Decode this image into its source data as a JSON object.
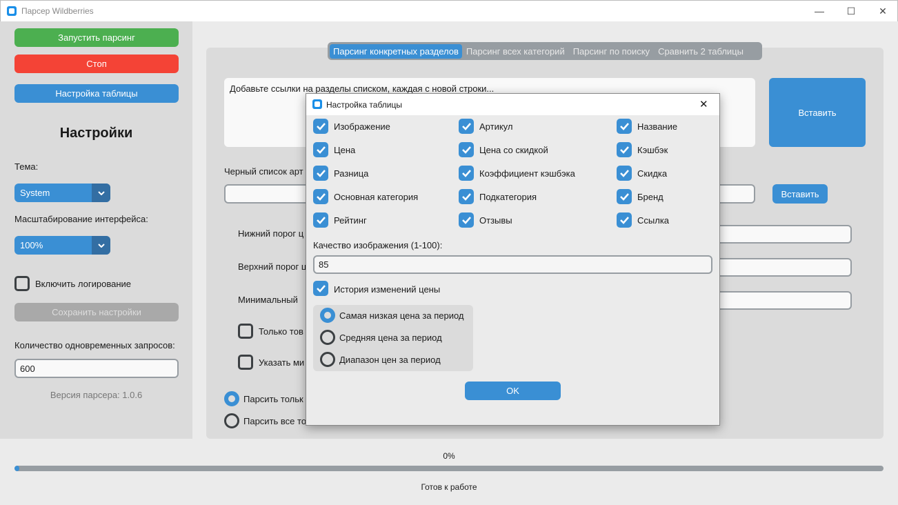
{
  "window": {
    "title": "Парсер Wildberries",
    "minimize": "—",
    "maximize": "☐",
    "close": "✕"
  },
  "sidebar": {
    "start_label": "Запустить парсинг",
    "stop_label": "Стоп",
    "table_settings_label": "Настройка таблицы",
    "heading": "Настройки",
    "theme_label": "Тема:",
    "theme_value": "System",
    "scale_label": "Масштабирование интерфейса:",
    "scale_value": "100%",
    "logging_label": "Включить логирование",
    "save_label": "Сохранить настройки",
    "requests_label": "Количество одновременных запросов:",
    "requests_value": "600",
    "version": "Версия парсера: 1.0.6"
  },
  "tabs": [
    {
      "label": "Парсинг конкретных разделов",
      "active": true
    },
    {
      "label": "Парсинг всех категорий"
    },
    {
      "label": "Парсинг по поиску"
    },
    {
      "label": "Сравнить 2 таблицы"
    }
  ],
  "main": {
    "links_placeholder": "Добавьте ссылки на разделы списком, каждая с новой строки...",
    "insert_label": "Вставить",
    "blacklist_label": "Черный список арт",
    "insert_small_label": "Вставить",
    "min_price_label": "Нижний порог ц",
    "max_price_label": "Верхний порог ц",
    "min_label": "Минимальный",
    "only_check_label": "Только тов",
    "specify_check_label": "Указать ми",
    "radio_only": "Парсить тольк",
    "radio_all": "Парсить все то"
  },
  "footer": {
    "progress_text": "0%",
    "progress": 0.003,
    "status": "Готов к работе"
  },
  "dialog": {
    "title": "Настройка таблицы",
    "close": "✕",
    "columns": [
      {
        "label": "Изображение",
        "checked": true
      },
      {
        "label": "Артикул",
        "checked": true
      },
      {
        "label": "Название",
        "checked": true
      },
      {
        "label": "Цена",
        "checked": true
      },
      {
        "label": "Цена со скидкой",
        "checked": true
      },
      {
        "label": "Кэшбэк",
        "checked": true
      },
      {
        "label": "Разница",
        "checked": true
      },
      {
        "label": "Коэффициент кэшбэка",
        "checked": true
      },
      {
        "label": "Скидка",
        "checked": true
      },
      {
        "label": "Основная категория",
        "checked": true
      },
      {
        "label": "Подкатегория",
        "checked": true
      },
      {
        "label": "Бренд",
        "checked": true
      },
      {
        "label": "Рейтинг",
        "checked": true
      },
      {
        "label": "Отзывы",
        "checked": true
      },
      {
        "label": "Ссылка",
        "checked": true
      }
    ],
    "quality_label": "Качество изображения (1-100):",
    "quality_value": "85",
    "history_label": "История изменений цены",
    "radios": [
      {
        "label": "Самая низкая цена за период",
        "selected": true
      },
      {
        "label": "Средняя цена за период"
      },
      {
        "label": "Диапазон цен за период"
      }
    ],
    "ok_label": "OK"
  }
}
